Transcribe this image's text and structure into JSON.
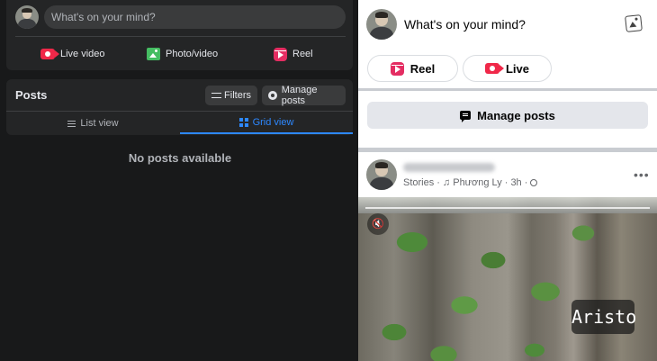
{
  "left_panel": {
    "composer": {
      "placeholder": "What's on your mind?",
      "actions": [
        {
          "label": "Live video",
          "icon": "live-video-icon"
        },
        {
          "label": "Photo/video",
          "icon": "photo-video-icon"
        },
        {
          "label": "Reel",
          "icon": "reel-icon"
        }
      ]
    },
    "posts": {
      "title": "Posts",
      "filters_label": "Filters",
      "manage_label": "Manage posts",
      "tabs": [
        {
          "label": "List view",
          "icon": "list-icon",
          "active": false
        },
        {
          "label": "Grid view",
          "icon": "grid-icon",
          "active": true
        }
      ],
      "empty_message": "No posts available"
    }
  },
  "right_panel": {
    "composer_prompt": "What's on your mind?",
    "buttons": {
      "reel_label": "Reel",
      "live_label": "Live",
      "manage_label": "Manage posts"
    },
    "post": {
      "meta": {
        "source": "Stories",
        "separator": "·",
        "music": "♫ Phương Ly",
        "time": "3h",
        "privacy_icon": "globe-icon"
      },
      "more_label": "•••",
      "mute_glyph": "🔇",
      "media_tag": "Aristo"
    }
  },
  "colors": {
    "dark_bg": "#18191a",
    "dark_card": "#242526",
    "accent_blue": "#2d88ff",
    "live_red": "#f02849",
    "photo_green": "#45bd62",
    "reel_pink": "#e42d62"
  }
}
